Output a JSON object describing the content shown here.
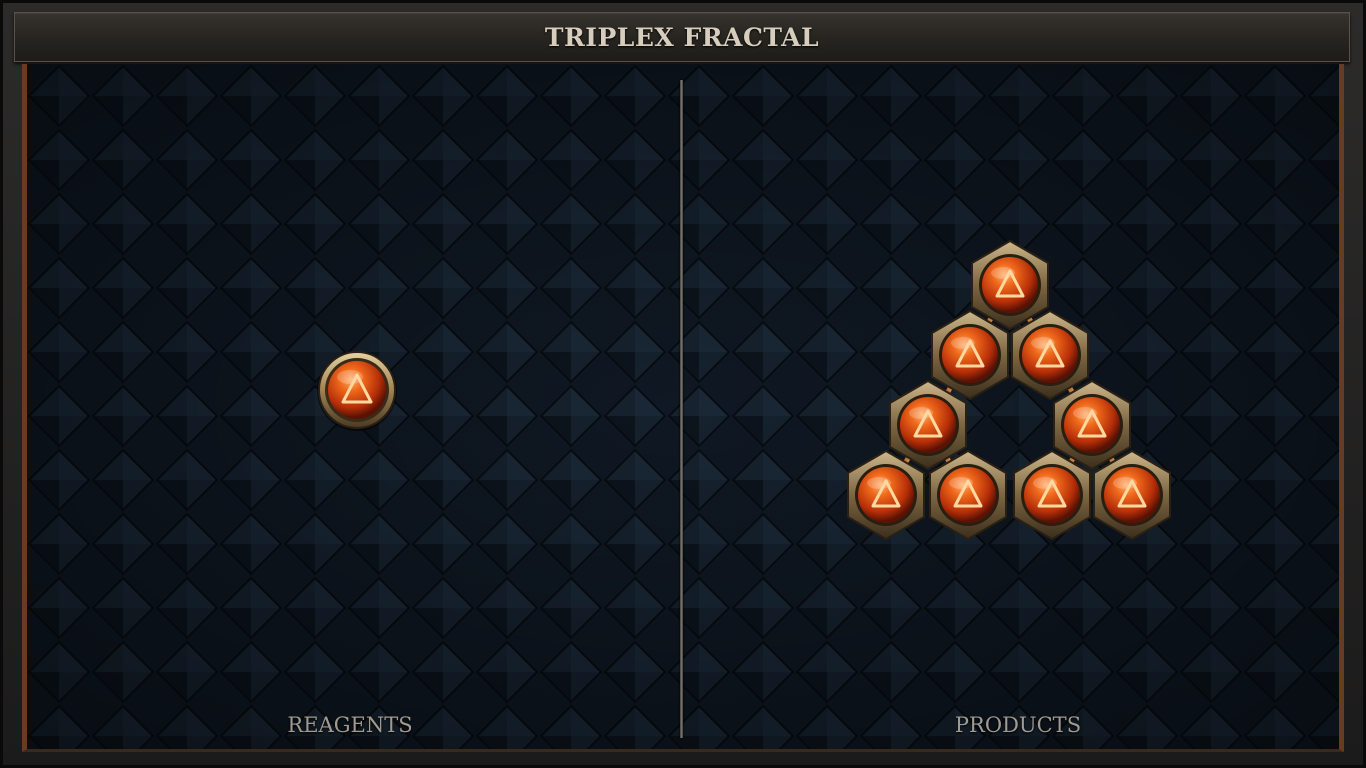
{
  "title": "TRIPLEX FRACTAL",
  "panels": {
    "left_label": "REAGENTS",
    "right_label": "PRODUCTS"
  },
  "reagents": [
    {
      "name": "orb",
      "symbol": "triangle",
      "color": "#e05812"
    }
  ],
  "products": {
    "shape": "triangle",
    "orb_count": 9,
    "symbol": "triangle",
    "color": "#e05812"
  },
  "colors": {
    "frame": "#1c1b1b",
    "board": "#0f1823",
    "accent_border": "#6a3b1e",
    "orb": "#e05812",
    "metal": "#b89c6e"
  }
}
